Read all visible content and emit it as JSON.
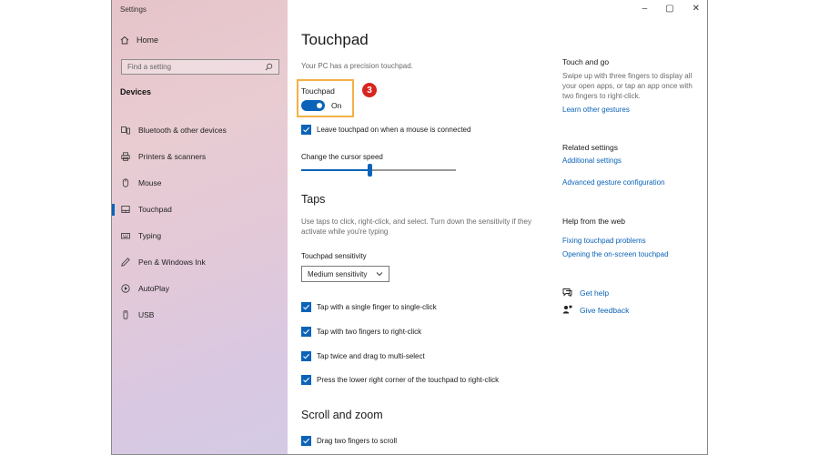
{
  "window": {
    "title": "Settings",
    "minimize": "–",
    "maximize": "▢",
    "close": "✕"
  },
  "sidebar": {
    "home": "Home",
    "search_placeholder": "Find a setting",
    "section": "Devices",
    "items": [
      {
        "label": "Bluetooth & other devices",
        "icon": "bluetooth-icon"
      },
      {
        "label": "Printers & scanners",
        "icon": "printer-icon"
      },
      {
        "label": "Mouse",
        "icon": "mouse-icon"
      },
      {
        "label": "Touchpad",
        "icon": "touchpad-icon",
        "active": true
      },
      {
        "label": "Typing",
        "icon": "keyboard-icon"
      },
      {
        "label": "Pen & Windows Ink",
        "icon": "pen-icon"
      },
      {
        "label": "AutoPlay",
        "icon": "autoplay-icon"
      },
      {
        "label": "USB",
        "icon": "usb-icon"
      }
    ]
  },
  "main": {
    "title": "Touchpad",
    "precision_note": "Your PC has a precision touchpad.",
    "touchpad_label": "Touchpad",
    "toggle_state": "On",
    "step_badge": "3",
    "leave_on_label": "Leave touchpad on when a mouse is connected",
    "cursor_speed_label": "Change the cursor speed",
    "cursor_speed_level": 0.44,
    "taps_heading": "Taps",
    "taps_desc": "Use taps to click, right-click, and select. Turn down the sensitivity if they activate while you're typing",
    "sensitivity_label": "Touchpad sensitivity",
    "sensitivity_value": "Medium sensitivity",
    "tap_options": [
      "Tap with a single finger to single-click",
      "Tap with two fingers to right-click",
      "Tap twice and drag to multi-select",
      "Press the lower right corner of the touchpad to right-click"
    ],
    "scroll_heading": "Scroll and zoom",
    "scroll_option": "Drag two fingers to scroll"
  },
  "side": {
    "touch_go_heading": "Touch and go",
    "touch_go_text": "Swipe up with three fingers to display all your open apps, or tap an app once with two fingers to right-click.",
    "touch_go_link": "Learn other gestures",
    "related_heading": "Related settings",
    "related_links": [
      "Additional settings",
      "Advanced gesture configuration"
    ],
    "help_heading": "Help from the web",
    "help_links": [
      "Fixing touchpad problems",
      "Opening the on-screen touchpad"
    ],
    "get_help": "Get help",
    "give_feedback": "Give feedback"
  },
  "colors": {
    "accent": "#0a63b8",
    "highlight": "#f5b146",
    "badge": "#d7261f"
  }
}
